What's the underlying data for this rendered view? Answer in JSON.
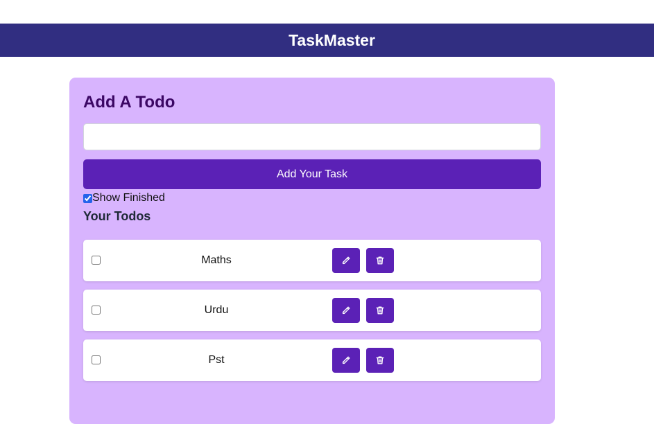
{
  "header": {
    "title": "TaskMaster"
  },
  "add_todo": {
    "heading": "Add A Todo",
    "input_value": "",
    "input_placeholder": "",
    "button_label": "Add Your Task"
  },
  "filter": {
    "show_finished_label": "Show Finished",
    "show_finished_checked": true
  },
  "todos_section": {
    "heading": "Your Todos",
    "items": [
      {
        "text": "Maths",
        "completed": false,
        "edit_icon": "pencil-icon",
        "delete_icon": "trash-icon"
      },
      {
        "text": "Urdu",
        "completed": false,
        "edit_icon": "pencil-icon",
        "delete_icon": "trash-icon"
      },
      {
        "text": "Pst",
        "completed": false,
        "edit_icon": "pencil-icon",
        "delete_icon": "trash-icon"
      }
    ]
  },
  "colors": {
    "header_bg": "#312e81",
    "panel_bg": "#d8b4fe",
    "accent": "#5b21b6",
    "heading_text": "#3b0764"
  }
}
